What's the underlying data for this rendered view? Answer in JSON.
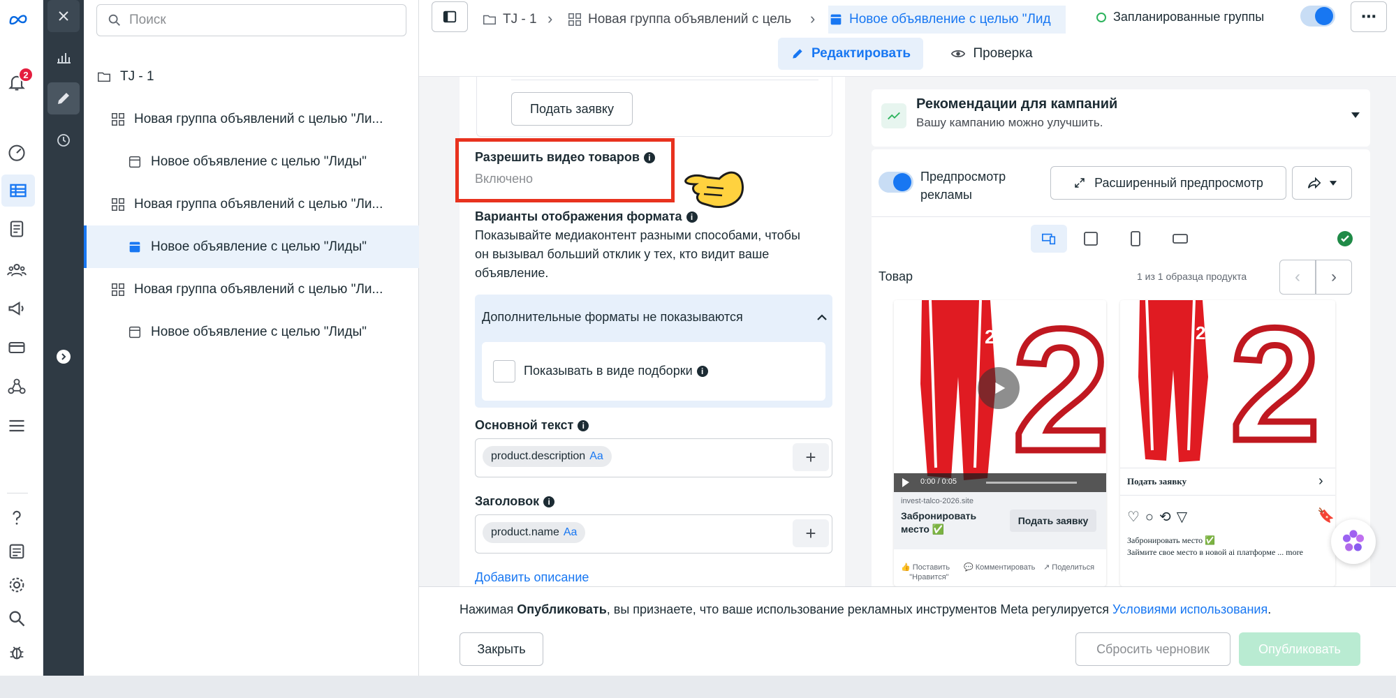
{
  "rail": {
    "notification_count": "2",
    "icons": [
      "meta-logo-icon",
      "bell-icon",
      "dashboard-icon",
      "table-icon",
      "pages-icon",
      "audience-icon",
      "megaphone-icon",
      "billing-icon",
      "network-icon",
      "menu-icon",
      "help-icon",
      "news-icon",
      "settings-icon",
      "search-icon",
      "bug-icon"
    ]
  },
  "tree": {
    "search_placeholder": "Поиск",
    "items": [
      {
        "label": "TJ - 1",
        "kind": "campaign"
      },
      {
        "label": "Новая группа объявлений с целью \"Ли...",
        "kind": "adset"
      },
      {
        "label": "Новое объявление с целью \"Лиды\"",
        "kind": "ad"
      },
      {
        "label": "Новая группа объявлений с целью \"Ли...",
        "kind": "adset"
      },
      {
        "label": "Новое объявление с целью \"Лиды\"",
        "kind": "ad",
        "selected": true
      },
      {
        "label": "Новая группа объявлений с целью \"Ли...",
        "kind": "adset"
      },
      {
        "label": "Новое объявление с целью \"Лиды\"",
        "kind": "ad"
      }
    ]
  },
  "topbar": {
    "crumb1": "TJ - 1",
    "crumb2": "Новая группа объявлений с цель",
    "crumb3": "Новое объявление с целью \"Лид",
    "scheduled": "Запланированные группы",
    "tab_edit": "Редактировать",
    "tab_review": "Проверка"
  },
  "form": {
    "submit_button": "Подать заявку",
    "video_label": "Разрешить видео товаров",
    "video_status": "Включено",
    "formats_label": "Варианты отображения формата",
    "formats_desc_1": "Показывайте медиаконтент разными способами, чтобы",
    "formats_desc_2": "он вызывал больший отклик у тех, кто видит ваше",
    "formats_desc_3": "объявление.",
    "extra_formats": "Дополнительные форматы не показываются",
    "collection_checkbox": "Показывать в виде подборки",
    "primary_text_label": "Основной текст",
    "primary_text_chip": "product.description",
    "headline_label": "Заголовок",
    "headline_chip": "product.name",
    "chip_suffix": "Aa",
    "add_description": "Добавить описание"
  },
  "recommendations": {
    "title": "Рекомендации для кампаний",
    "subtitle": "Вашу кампанию можно улучшить."
  },
  "preview": {
    "toggle_label_1": "Предпросмотр",
    "toggle_label_2": "рекламы",
    "advanced_button": "Расширенный предпросмотр",
    "product_label": "Товар",
    "sample_count": "1 из 1 образца продукта",
    "fb_domain": "invest-talco-2026.site",
    "fb_title_1": "Забронировать",
    "fb_title_2": "место ✅",
    "fb_cta": "Подать заявку",
    "fb_time": "0:00 / 0:05",
    "fb_like_1": "Поставить",
    "fb_like_2": "\"Нравится\"",
    "fb_comment": "Комментировать",
    "fb_share": "Поделиться",
    "ig_cta": "Подать заявку",
    "ig_caption_1": "Забронировать место ✅",
    "ig_caption_2": "Займите свое место в новой ai платформе ... more",
    "jersey_number": "2"
  },
  "footer": {
    "notice_pre": "Нажимая ",
    "notice_bold": "Опубликовать",
    "notice_mid": ", вы признаете, что ваше использование рекламных инструментов Meta регулируется ",
    "notice_link": "Условиями использования",
    "notice_end": ".",
    "close_button": "Закрыть",
    "reset_button": "Сбросить черновик",
    "publish_button": "Опубликовать"
  },
  "colors": {
    "accent": "#1877f2",
    "highlight_box": "#e8321e",
    "pants_red": "#e01b22",
    "publish_disabled": "#b9ebd2"
  }
}
